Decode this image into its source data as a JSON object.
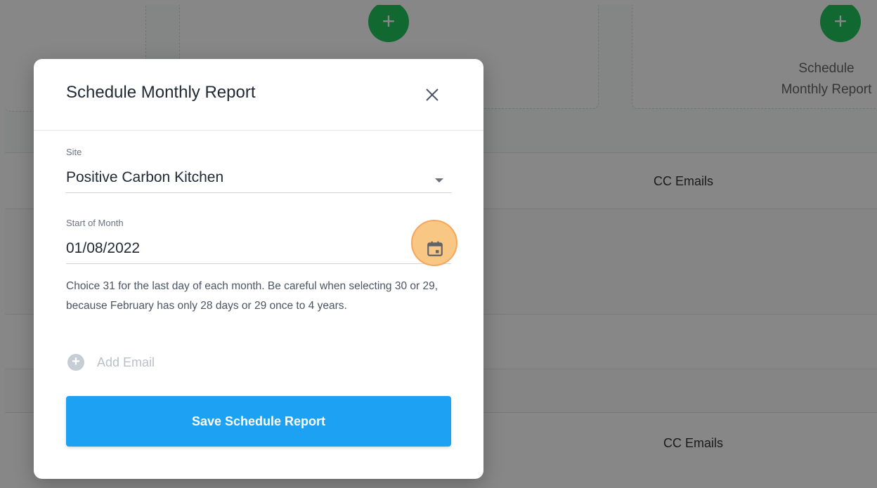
{
  "background": {
    "card_label": "Schedule Monthly Report",
    "cc_label_1": "CC Emails",
    "cc_label_2": "CC Emails",
    "plus_glyph": "+"
  },
  "modal": {
    "title": "Schedule Monthly Report",
    "site": {
      "label": "Site",
      "value": "Positive Carbon Kitchen"
    },
    "start_month": {
      "label": "Start of Month",
      "value": "01/08/2022"
    },
    "help_text": "Choice 31 for the last day of each month. Be careful when selecting 30 or 29, because February has only 28 days or 29 once to 4 years.",
    "add_email_label": "Add Email",
    "save_label": "Save Schedule Report"
  },
  "colors": {
    "primary_button": "#1da1f2",
    "add_green": "#22c55e",
    "highlight": "#f9c784"
  },
  "icons": {
    "close": "close-icon",
    "calendar": "calendar-icon",
    "dropdown": "chevron-down-icon",
    "add": "plus-circle-icon"
  }
}
